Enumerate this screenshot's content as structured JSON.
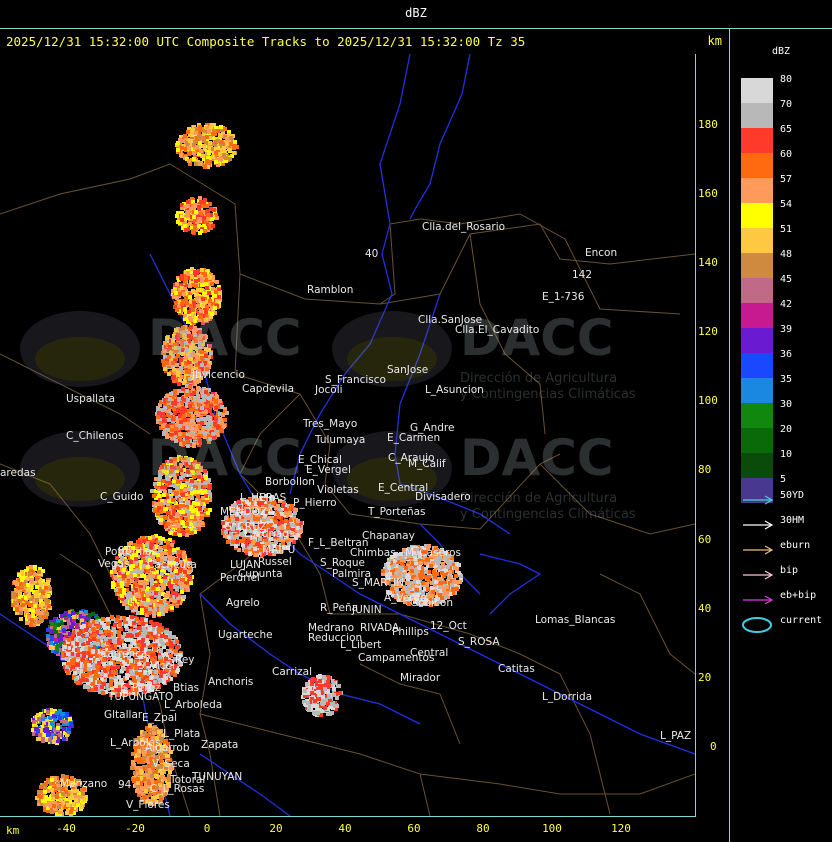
{
  "header": {
    "unit_label": "dBZ"
  },
  "title": "2025/12/31 15:32:00 UTC Composite Tracks to 2025/12/31 15:32:00 Tz 35",
  "km_top": "km",
  "km_bottom": "km",
  "y_ticks": [
    "180",
    "160",
    "140",
    "120",
    "100",
    "80",
    "60",
    "40",
    "20",
    "0"
  ],
  "x_ticks": [
    "-40",
    "-20",
    "0",
    "20",
    "40",
    "60",
    "80",
    "100",
    "120"
  ],
  "legend": {
    "title": "dBZ",
    "levels": [
      {
        "value": "80",
        "color": "#d8d8d8"
      },
      {
        "value": "70",
        "color": "#b8b8b8"
      },
      {
        "value": "65",
        "color": "#ff3a2a"
      },
      {
        "value": "60",
        "color": "#ff6a10"
      },
      {
        "value": "57",
        "color": "#ff9a5a"
      },
      {
        "value": "54",
        "color": "#ffff00"
      },
      {
        "value": "51",
        "color": "#ffc840"
      },
      {
        "value": "48",
        "color": "#d08a40"
      },
      {
        "value": "45",
        "color": "#c06a88"
      },
      {
        "value": "42",
        "color": "#c81a90"
      },
      {
        "value": "39",
        "color": "#6a1ad0"
      },
      {
        "value": "36",
        "color": "#1a48ff"
      },
      {
        "value": "35",
        "color": "#1a88e0"
      },
      {
        "value": "30",
        "color": "#108810"
      },
      {
        "value": "20",
        "color": "#0a6a0a"
      },
      {
        "value": "10",
        "color": "#0a4a0a"
      },
      {
        "value": "5",
        "color": "#483890"
      }
    ],
    "tracks": [
      {
        "label": "50YD",
        "color": "#50d0d0"
      },
      {
        "label": "30HM",
        "color": "#ffffff"
      },
      {
        "label": "eburn",
        "color": "#e8c080"
      },
      {
        "label": "bip",
        "color": "#ffc8d0"
      },
      {
        "label": "eb+bip",
        "color": "#e040e0"
      },
      {
        "label": "current",
        "color": "#3ad0e8"
      }
    ]
  },
  "watermark": {
    "brand": "DACC",
    "line1": "Dirección de Agricultura",
    "line2": "y Contingencias Climáticas"
  },
  "places": [
    {
      "name": "Clla.del_Rosario"
    },
    {
      "name": "Encon"
    },
    {
      "name": "Ramblon"
    },
    {
      "name": "E_1-736"
    },
    {
      "name": "Clla.SanJose"
    },
    {
      "name": "Clla.El_Cavadito"
    },
    {
      "name": "SanJose"
    },
    {
      "name": "S_Francisco"
    },
    {
      "name": "L_Asuncion"
    },
    {
      "name": "Jocoli"
    },
    {
      "name": "Capdevila"
    },
    {
      "name": "Uspallata"
    },
    {
      "name": "Jbvicencio"
    },
    {
      "name": "C_Chilenos"
    },
    {
      "name": "Tres_Mayo"
    },
    {
      "name": "Tulumaya"
    },
    {
      "name": "G_Andre"
    },
    {
      "name": "E_Carmen"
    },
    {
      "name": "E_Chical"
    },
    {
      "name": "E_Vergel"
    },
    {
      "name": "C_Araujo"
    },
    {
      "name": "M_Calif"
    },
    {
      "name": "Borbollon"
    },
    {
      "name": "Violetas"
    },
    {
      "name": "E_Central"
    },
    {
      "name": "Divisadero"
    },
    {
      "name": "L_HERAS"
    },
    {
      "name": "P_Hierro"
    },
    {
      "name": "C_Guido"
    },
    {
      "name": "MENDOZA"
    },
    {
      "name": "T_Porteñas"
    },
    {
      "name": "G_CRUZ"
    },
    {
      "name": "Luzuriaga"
    },
    {
      "name": "Chapanay"
    },
    {
      "name": "F_L_Beltran"
    },
    {
      "name": "MAIPU"
    },
    {
      "name": "Russel"
    },
    {
      "name": "Chimbas"
    },
    {
      "name": "M_Caseros"
    },
    {
      "name": "Potrerillos"
    },
    {
      "name": "Vegas"
    },
    {
      "name": "Cacheuta"
    },
    {
      "name": "LUJAN"
    },
    {
      "name": "Cupunta"
    },
    {
      "name": "S_Roque"
    },
    {
      "name": "Palmira"
    },
    {
      "name": "Perdriel"
    },
    {
      "name": "S_MARTIN"
    },
    {
      "name": "A_Verde"
    },
    {
      "name": "Gobicon"
    },
    {
      "name": "Agrelo"
    },
    {
      "name": "R_Peña"
    },
    {
      "name": "JUNIN"
    },
    {
      "name": "Lomas_Blancas"
    },
    {
      "name": "Medrano"
    },
    {
      "name": "RIVADA"
    },
    {
      "name": "Phillips"
    },
    {
      "name": "12_Oct"
    },
    {
      "name": "Ugarteche"
    },
    {
      "name": "Reduccion"
    },
    {
      "name": "L_Libert"
    },
    {
      "name": "S_ROSA"
    },
    {
      "name": "Carrenca"
    },
    {
      "name": "Central"
    },
    {
      "name": "Campamentos"
    },
    {
      "name": "Catitas"
    },
    {
      "name": "S_Vicel"
    },
    {
      "name": "Rey"
    },
    {
      "name": "Carrizal"
    },
    {
      "name": "Mirador"
    },
    {
      "name": "E_Perez"
    },
    {
      "name": "Btias"
    },
    {
      "name": "Anchoris"
    },
    {
      "name": "TUPUNGATO"
    },
    {
      "name": "L_Dorrida"
    },
    {
      "name": "L_Arboleda"
    },
    {
      "name": "Gltallar"
    },
    {
      "name": "E_Zpal"
    },
    {
      "name": "L_PAZ"
    },
    {
      "name": "L_Arboles"
    },
    {
      "name": "L_Plata"
    },
    {
      "name": "Zapata"
    },
    {
      "name": "Algarrob"
    },
    {
      "name": "V_Seca"
    },
    {
      "name": "Totoral"
    },
    {
      "name": "Manzano"
    },
    {
      "name": "TUNUYAN"
    },
    {
      "name": "C_L_Rosas"
    },
    {
      "name": "V_Flores"
    },
    {
      "name": "aredas"
    },
    {
      "name": "142"
    },
    {
      "name": "40"
    },
    {
      "name": "88"
    },
    {
      "name": "94"
    }
  ]
}
